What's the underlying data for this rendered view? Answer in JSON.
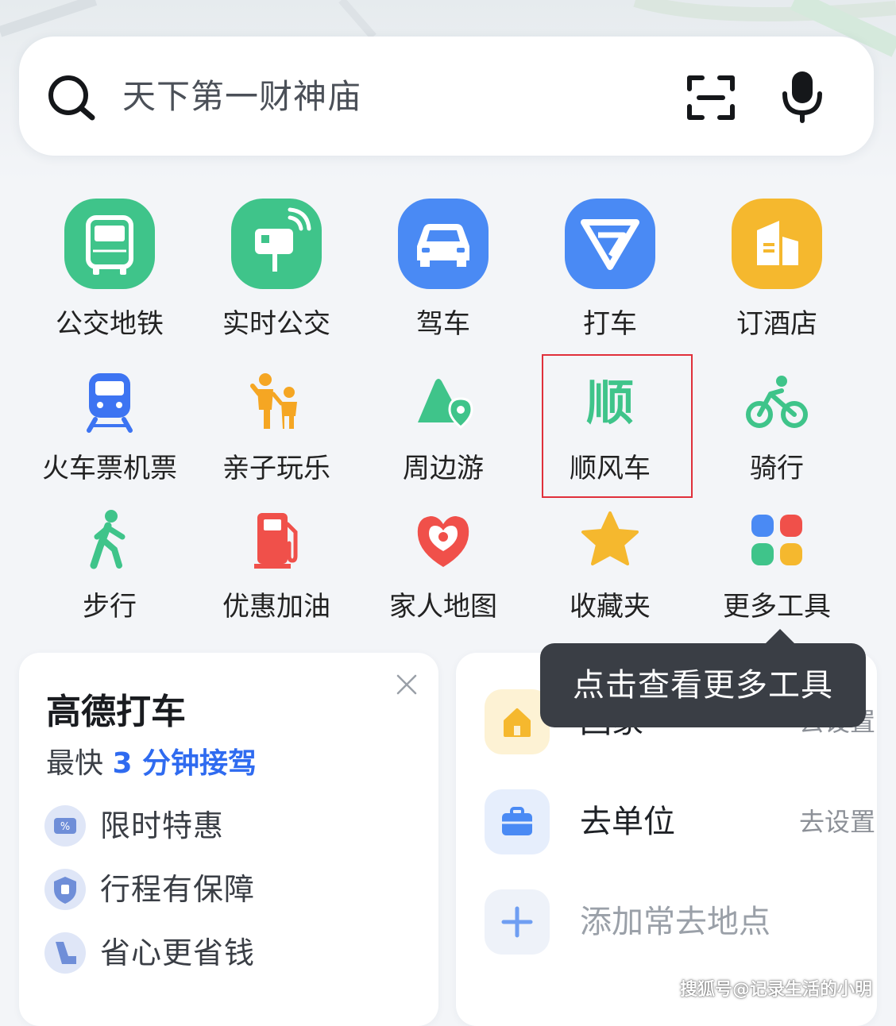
{
  "search": {
    "text": "天下第一财神庙",
    "left_icon": "search-icon",
    "right_icons": [
      "scan-icon",
      "microphone-icon"
    ]
  },
  "tools": {
    "row1": [
      {
        "label": "公交地铁",
        "icon": "bus-icon",
        "color": "#3fc48a"
      },
      {
        "label": "实时公交",
        "icon": "realtime-bus-stop-icon",
        "color": "#3fc48a"
      },
      {
        "label": "驾车",
        "icon": "car-icon",
        "color": "#4a8af4"
      },
      {
        "label": "打车",
        "icon": "taxi-icon",
        "color": "#4a8af4"
      },
      {
        "label": "订酒店",
        "icon": "hotel-icon",
        "color": "#f5b82e"
      }
    ],
    "row2": [
      {
        "label": "火车票机票",
        "icon": "train-icon",
        "color": "#3d74f2"
      },
      {
        "label": "亲子玩乐",
        "icon": "family-icon",
        "color": "#f5a623"
      },
      {
        "label": "周边游",
        "icon": "mountain-pin-icon",
        "color": "#3fc48a"
      },
      {
        "label": "顺风车",
        "icon": "shunfeng-icon",
        "color": "#3fc48a",
        "glyph": "顺"
      },
      {
        "label": "骑行",
        "icon": "bicycle-icon",
        "color": "#3fc48a"
      }
    ],
    "row3": [
      {
        "label": "步行",
        "icon": "walking-icon",
        "color": "#3fc48a"
      },
      {
        "label": "优惠加油",
        "icon": "gas-pump-icon",
        "color": "#f0504a"
      },
      {
        "label": "家人地图",
        "icon": "family-map-icon",
        "color": "#f0504a"
      },
      {
        "label": "收藏夹",
        "icon": "star-icon",
        "color": "#f5b82e"
      },
      {
        "label": "更多工具",
        "icon": "more-tools-icon",
        "color": "#4a8af4"
      }
    ]
  },
  "taxi_card": {
    "title": "高德打车",
    "subtitle_prefix": "最快 ",
    "subtitle_highlight": "3 分钟接驾",
    "perks": [
      {
        "label": "限时特惠",
        "icon": "discount-ticket-icon"
      },
      {
        "label": "行程有保障",
        "icon": "insurance-badge-icon"
      },
      {
        "label": "省心更省钱",
        "icon": "seat-icon"
      }
    ]
  },
  "places_card": {
    "rows": [
      {
        "name": "回家",
        "action": "去设置",
        "icon": "home-icon"
      },
      {
        "name": "去单位",
        "action": "去设置",
        "icon": "briefcase-icon"
      },
      {
        "name": "添加常去地点",
        "action": "",
        "icon": "plus-icon"
      }
    ]
  },
  "tooltip": {
    "text": "点击查看更多工具"
  },
  "watermark": {
    "text": "搜狐号@记录生活的小明"
  },
  "colors": {
    "green": "#3fc48a",
    "blue": "#4a8af4",
    "accent_text": "#2f6bf0",
    "highlight_border": "#e0303b"
  }
}
